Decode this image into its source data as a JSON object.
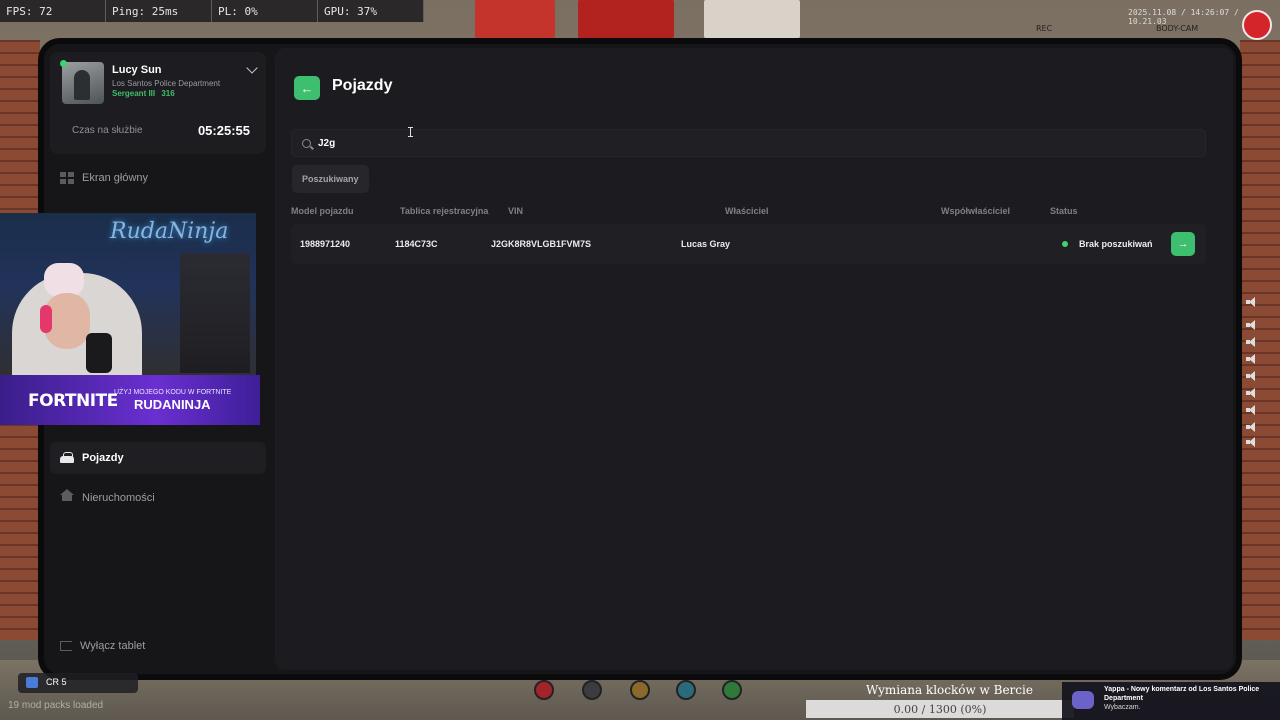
{
  "hud": {
    "fps": "FPS: 72",
    "ping": "Ping: 25ms",
    "pl": "PL: 0%",
    "gpu": "GPU: 37%",
    "rec": "REC",
    "bodycam": "BODY-CAM",
    "date": "2025.11.08 / 14:26:07 / 10.21.03"
  },
  "profile": {
    "name": "Lucy Sun",
    "department": "Los Santos Police Department",
    "rank": "Sergeant III",
    "badge": "316",
    "duty_label": "Czas na służbie",
    "duty_time": "05:25:55"
  },
  "nav": {
    "home": "Ekran główny",
    "vehicles": "Pojazdy",
    "properties": "Nieruchomości",
    "logout": "Wyłącz tablet"
  },
  "stream": {
    "neon_text": "RudaNinja",
    "game": "FORTNITE",
    "promo": "UŻYJ MOJEGO KODU W FORTNITE",
    "code": "RUDANINJA"
  },
  "main": {
    "title": "Pojazdy",
    "back_icon": "arrow-left-icon",
    "search_value": "J2g",
    "filter_label": "Poszukiwany",
    "columns": [
      "Model pojazdu",
      "Tablica rejestracyjna",
      "VIN",
      "Właściciel",
      "Współwłaściciel",
      "Status"
    ],
    "rows": [
      {
        "model": "1988971240",
        "plate": "1184C73C",
        "vin": "J2GK8R8VLGB1FVM7S",
        "owner": "Lucas Gray",
        "co_owner": "",
        "status": "Brak poszukiwań",
        "status_color": "#3fd26e"
      }
    ]
  },
  "bottom": {
    "chat_label": "CR 5",
    "faint_text": "19 mod packs loaded",
    "progress_title": "Wymiana klocków w Bercie",
    "progress_text": "0.00 / 1300 (0%)",
    "progress_fraction": 0,
    "notification_title": "Yappa - Nowy komentarz od Los Santos Police Department",
    "notification_body": "Wybaczam."
  },
  "colors": {
    "accent": "#3dbf6f",
    "tablet_bg": "#161619",
    "panel_bg": "#1c1c20"
  }
}
